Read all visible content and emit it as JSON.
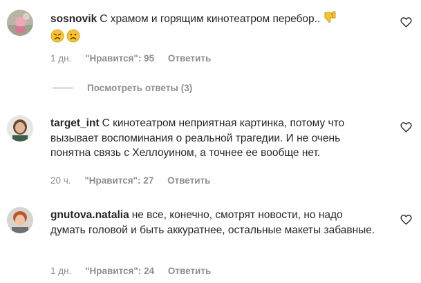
{
  "comments": [
    {
      "username": "sosnovik",
      "text": "С храмом и горящим кинотеатром перебор..",
      "time": "1 дн.",
      "likes": "\"Нравится\": 95",
      "reply": "Ответить",
      "emojis": [
        "thumbs-down-icon",
        "angry-face-icon",
        "frowning-face-icon"
      ]
    },
    {
      "username": "target_int",
      "text": "С кинотеатром неприятная картинка, потому что вызывает воспоминания о реальной трагедии. И не очень понятна связь с Хеллоуином, а точнее ее вообще нет.",
      "time": "20 ч.",
      "likes": "\"Нравится\": 27",
      "reply": "Ответить"
    },
    {
      "username": "gnutova.natalia",
      "text": "не все, конечно, смотрят новости, но надо думать головой и быть аккуратнее, остальные макеты забавные.",
      "time": "1 дн.",
      "likes": "\"Нравится\": 24",
      "reply": "Ответить"
    }
  ],
  "view_replies": "Посмотреть ответы (3)",
  "colors": {
    "text": "#262626",
    "secondary": "#8e8e8e",
    "emoji_yellow": "#f7c32e"
  },
  "icons": [
    "heart-outline-icon"
  ]
}
